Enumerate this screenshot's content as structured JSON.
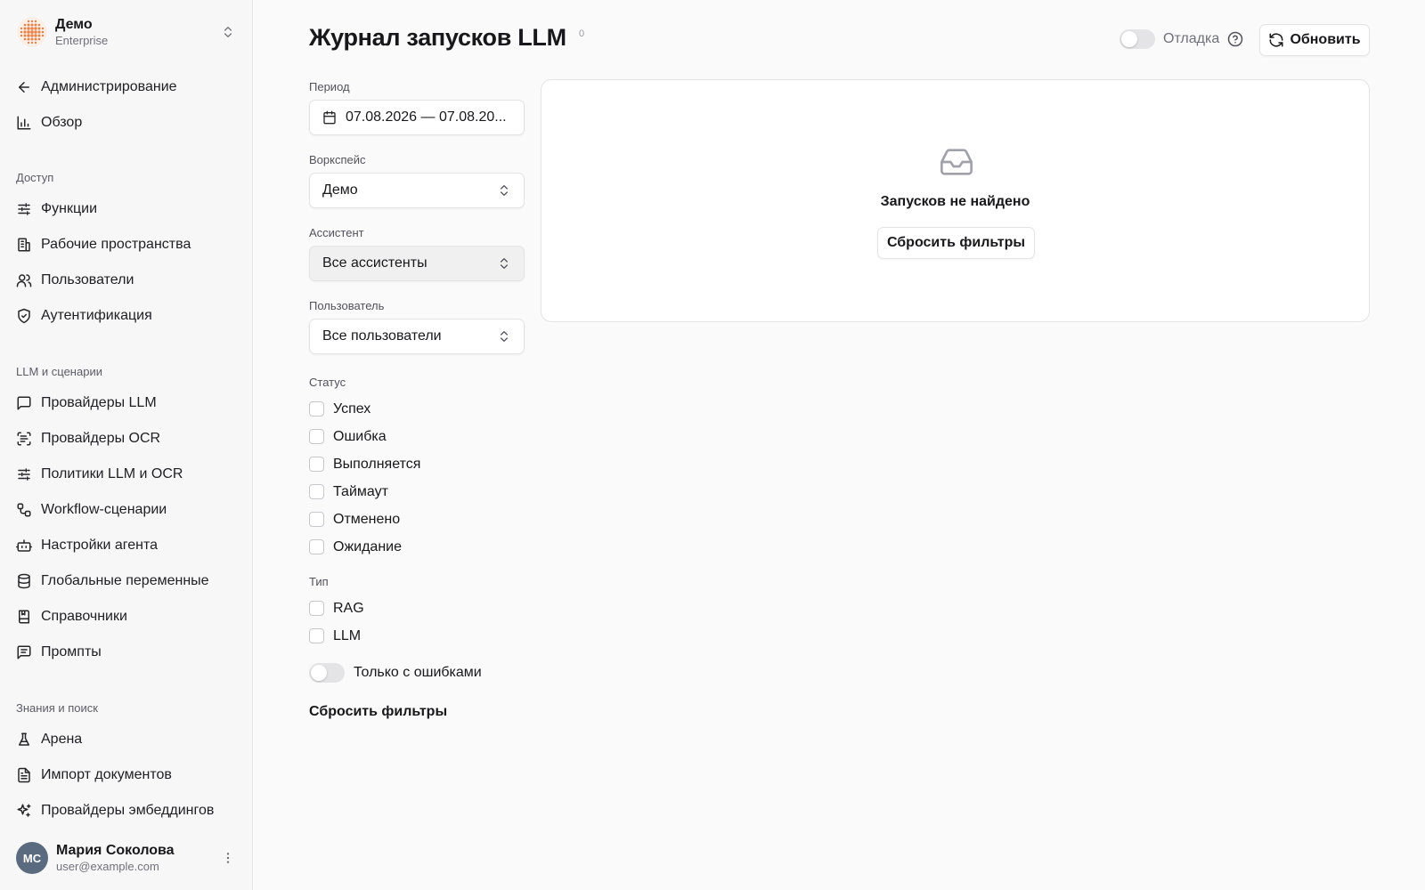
{
  "workspace": {
    "name": "Демо",
    "plan": "Enterprise"
  },
  "sidebar": {
    "top_items": [
      {
        "label": "Администрирование",
        "icon": "arrow-left-icon"
      },
      {
        "label": "Обзор",
        "icon": "bar-chart-icon"
      }
    ],
    "sections": [
      {
        "title": "Доступ",
        "items": [
          {
            "label": "Функции",
            "icon": "sliders-icon"
          },
          {
            "label": "Рабочие пространства",
            "icon": "building-icon"
          },
          {
            "label": "Пользователи",
            "icon": "users-icon"
          },
          {
            "label": "Аутентификация",
            "icon": "shield-check-icon"
          }
        ]
      },
      {
        "title": "LLM и сценарии",
        "items": [
          {
            "label": "Провайдеры LLM",
            "icon": "message-square-icon"
          },
          {
            "label": "Провайдеры OCR",
            "icon": "scan-text-icon"
          },
          {
            "label": "Политики LLM и OCR",
            "icon": "sliders-icon"
          },
          {
            "label": "Workflow-сценарии",
            "icon": "workflow-icon"
          },
          {
            "label": "Настройки агента",
            "icon": "bot-icon"
          },
          {
            "label": "Глобальные переменные",
            "icon": "database-icon"
          },
          {
            "label": "Справочники",
            "icon": "book-icon"
          },
          {
            "label": "Промпты",
            "icon": "message-lines-icon"
          }
        ]
      },
      {
        "title": "Знания и поиск",
        "items": [
          {
            "label": "Арена",
            "icon": "flask-icon"
          },
          {
            "label": "Импорт документов",
            "icon": "file-text-icon"
          },
          {
            "label": "Провайдеры эмбеддингов",
            "icon": "sparkles-icon"
          }
        ]
      }
    ]
  },
  "user": {
    "initials": "МС",
    "name": "Мария Соколова",
    "email": "user@example.com"
  },
  "header": {
    "title": "Журнал запусков LLM",
    "count": "0",
    "debug_label": "Отладка",
    "refresh_label": "Обновить"
  },
  "filters": {
    "period": {
      "label": "Период",
      "value": "07.08.2026 — 07.08.20..."
    },
    "workspace": {
      "label": "Воркспейс",
      "value": "Демо"
    },
    "assistant": {
      "label": "Ассистент",
      "value": "Все ассистенты"
    },
    "user": {
      "label": "Пользователь",
      "value": "Все пользователи"
    },
    "status": {
      "label": "Статус",
      "options": [
        "Успех",
        "Ошибка",
        "Выполняется",
        "Таймаут",
        "Отменено",
        "Ожидание"
      ]
    },
    "type": {
      "label": "Тип",
      "options": [
        "RAG",
        "LLM"
      ]
    },
    "errors_only_label": "Только с ошибками",
    "reset_label": "Сбросить фильтры"
  },
  "results": {
    "empty_text": "Запусков не найдено",
    "reset_label": "Сбросить фильтры"
  },
  "colors": {
    "accent": "#e8834a",
    "text": "#18181b",
    "muted": "#71717a",
    "border": "#e4e4e7"
  }
}
